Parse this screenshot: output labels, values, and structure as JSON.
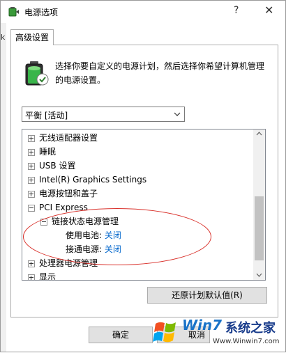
{
  "window": {
    "title": "电源选项",
    "help_glyph": "?",
    "close_glyph": "✕"
  },
  "left_strip_glyph": "k",
  "tab": {
    "label": "高级设置"
  },
  "description": "选择你要自定义的电源计划，然后选择你希望计算机管理的电源设置。",
  "plan_select": {
    "value": "平衡 [活动]"
  },
  "tree": {
    "items": [
      {
        "label": "无线适配器设置",
        "expander": "plus"
      },
      {
        "label": "睡眠",
        "expander": "plus"
      },
      {
        "label": "USB 设置",
        "expander": "plus"
      },
      {
        "label": "Intel(R) Graphics Settings",
        "expander": "plus"
      },
      {
        "label": "电源按钮和盖子",
        "expander": "plus"
      },
      {
        "label": "PCI Express",
        "expander": "minus"
      },
      {
        "label": "链接状态电源管理",
        "expander": "minus"
      },
      {
        "label": "使用电池:",
        "value": "关闭"
      },
      {
        "label": "接通电源:",
        "value": "关闭"
      },
      {
        "label": "处理器电源管理",
        "expander": "plus"
      },
      {
        "label": "显示",
        "expander": "plus"
      }
    ]
  },
  "buttons": {
    "restore": "还原计划默认值(R)",
    "ok": "确定",
    "cancel": "取消"
  },
  "watermark": {
    "brand": "Win7",
    "cn": "系统之家",
    "url": "Www.Winwin7.com"
  },
  "colors": {
    "link": "#0066cc",
    "annotation": "#d9302a"
  }
}
